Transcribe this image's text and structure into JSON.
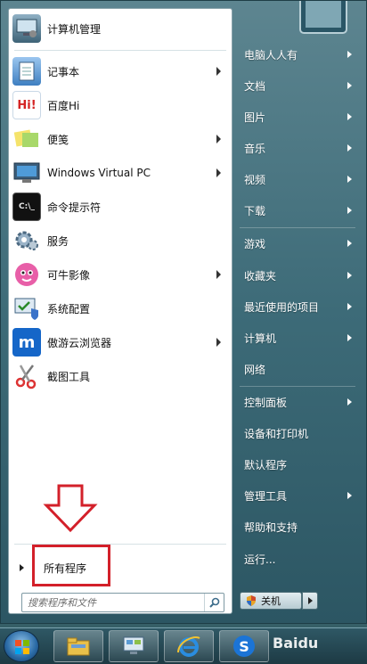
{
  "programs": [
    {
      "label": "计算机管理",
      "has_submenu": false,
      "icon": "computer-management-icon"
    },
    {
      "label": "记事本",
      "has_submenu": true,
      "icon": "notepad-icon"
    },
    {
      "label": "百度Hi",
      "has_submenu": false,
      "icon": "baidu-hi-icon",
      "icon_text": "Hi!"
    },
    {
      "label": "便笺",
      "has_submenu": true,
      "icon": "sticky-notes-icon"
    },
    {
      "label": "Windows Virtual PC",
      "has_submenu": true,
      "icon": "virtual-pc-icon"
    },
    {
      "label": "命令提示符",
      "has_submenu": false,
      "icon": "command-prompt-icon",
      "icon_text": "C:\\_"
    },
    {
      "label": "服务",
      "has_submenu": false,
      "icon": "services-icon"
    },
    {
      "label": "可牛影像",
      "has_submenu": true,
      "icon": "keniu-image-icon"
    },
    {
      "label": "系统配置",
      "has_submenu": false,
      "icon": "system-config-icon"
    },
    {
      "label": "傲游云浏览器",
      "has_submenu": true,
      "icon": "maxthon-browser-icon",
      "icon_text": "m"
    },
    {
      "label": "截图工具",
      "has_submenu": false,
      "icon": "snipping-tool-icon"
    }
  ],
  "all_programs": {
    "label": "所有程序"
  },
  "search": {
    "placeholder": "搜索程序和文件"
  },
  "right_items": [
    {
      "label": "电脑人人有",
      "has_submenu": true
    },
    {
      "label": "文档",
      "has_submenu": true
    },
    {
      "label": "图片",
      "has_submenu": true
    },
    {
      "label": "音乐",
      "has_submenu": true
    },
    {
      "label": "视频",
      "has_submenu": true
    },
    {
      "label": "下载",
      "has_submenu": true
    },
    {
      "label": "游戏",
      "has_submenu": true
    },
    {
      "label": "收藏夹",
      "has_submenu": true
    },
    {
      "label": "最近使用的项目",
      "has_submenu": true
    },
    {
      "label": "计算机",
      "has_submenu": true
    },
    {
      "label": "网络",
      "has_submenu": false
    },
    {
      "label": "控制面板",
      "has_submenu": true
    },
    {
      "label": "设备和打印机",
      "has_submenu": false
    },
    {
      "label": "默认程序",
      "has_submenu": false
    },
    {
      "label": "管理工具",
      "has_submenu": true
    },
    {
      "label": "帮助和支持",
      "has_submenu": false
    },
    {
      "label": "运行...",
      "has_submenu": false
    }
  ],
  "shutdown": {
    "label": "关机"
  },
  "taskbar": {
    "items": [
      {
        "name": "file-explorer-icon"
      },
      {
        "name": "control-panel-icon"
      },
      {
        "name": "internet-explorer-icon"
      },
      {
        "name": "sogou-browser-icon"
      }
    ],
    "watermark": "Baidu"
  },
  "colors": {
    "highlight_red": "#d3202a",
    "menu_blue": "#3d6b78"
  }
}
